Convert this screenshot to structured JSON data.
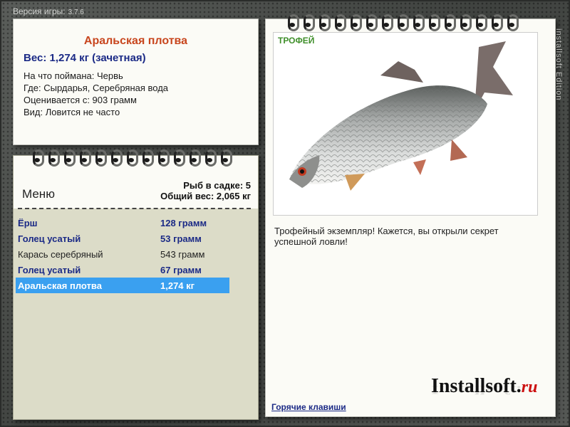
{
  "header": {
    "version_label": "Версия игры:",
    "version_num": "3.7.6"
  },
  "fish_info": {
    "title": "Аральская плотва",
    "weight": "Вес: 1,274 кг (зачетная)",
    "lines": [
      "На что поймана: Червь",
      "Где: Сырдарья, Серебряная вода",
      "Оценивается с: 903 грамм",
      "Вид: Ловится не часто"
    ]
  },
  "menu": {
    "title": "Меню",
    "stats_line1": "Рыб в садке: 5",
    "stats_line2": "Общий вес: 2,065 кг",
    "fish": [
      {
        "name": "Ёрш",
        "weight": "128 грамм",
        "style": "bold"
      },
      {
        "name": "Голец усатый",
        "weight": "53 грамм",
        "style": "bold"
      },
      {
        "name": "Карась серебряный",
        "weight": "543 грамм",
        "style": "plain"
      },
      {
        "name": "Голец усатый",
        "weight": "67 грамм",
        "style": "bold"
      },
      {
        "name": "Аральская плотва",
        "weight": "1,274 кг",
        "style": "selected"
      }
    ]
  },
  "trophy": {
    "badge": "ТРОФЕЙ",
    "description": "Трофейный экземпляр! Кажется, вы открыли секрет успешной ловли!",
    "hotkeys": "Горячие клавиши"
  },
  "branding": {
    "name": "Installsoft.",
    "tld": "ru",
    "side": "installsoft Edition"
  },
  "colors": {
    "selected": "#3aa0f0",
    "title": "#c8461e",
    "accent": "#1b2a86",
    "trophy": "#3f8f2a"
  }
}
